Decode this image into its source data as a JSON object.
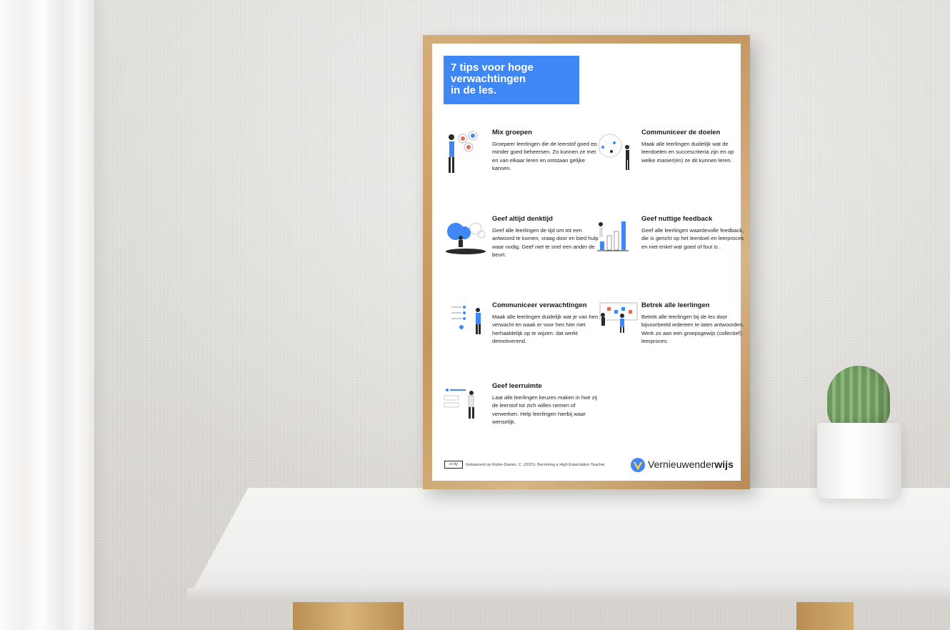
{
  "poster": {
    "title": "7 tips voor hoge\nverwachtingen\nin de les.",
    "tips": [
      {
        "heading": "Mix groepen",
        "text": "Groepeer leerlingen die de leerstof goed en minder goed beheersen. Zo kunnen ze met en van elkaar leren en ontstaan gelijke kansen."
      },
      {
        "heading": "Communiceer de doelen",
        "text": "Maak alle leerlingen duidelijk wat de leerdoelen en succescriteria zijn en op welke manier(en) ze dit kunnen leren."
      },
      {
        "heading": "Geef altijd denktijd",
        "text": "Geef alle leerlingen de tijd om tot een antwoord te komen, vraag door en bied hulp waar nodig. Geef niet te snel een ander de beurt."
      },
      {
        "heading": "Geef nuttige feedback",
        "text": "Geef alle leerlingen waardevolle feedback, die is gericht op het leerdoel en leerproces en niet enkel wat goed of fout is ."
      },
      {
        "heading": "Communiceer verwachtingen",
        "text": "Maak alle leerlingen duidelijk wat je van hen verwacht en waak er voor hen hier niet herhaaldelijk op te wijzen: dat werkt demotiverend."
      },
      {
        "heading": "Betrek alle leerlingen",
        "text": "Betrek alle leerlingen bij de les door bijvoorbeeld iedereen te laten antwoorden. Werk zo aan een groepsgewijs (collectief) leerproces."
      },
      {
        "heading": "Geef leerruimte",
        "text": "Laat alle leerlingen keuzes maken in hoe zij de leerstof tot zich willen nemen of verwerken. Help leerlingen hierbij waar wenselijk."
      }
    ],
    "footer": {
      "license_badge": "cc by",
      "citation": "Gebaseerd op Rubie-Davies, C. (2015). Becoming a High Expectation Teacher",
      "brand_regular": "Vernieuwender",
      "brand_bold": "wijs"
    }
  },
  "colors": {
    "accent": "#3f87f5",
    "frame": "#c8a06c",
    "wall": "#dedcd8"
  },
  "icons": [
    "people-group-icon",
    "target-diagram-icon",
    "thinking-person-icon",
    "bar-chart-icon",
    "checklist-icon",
    "board-icon",
    "options-list-icon",
    "brand-logo-icon"
  ]
}
